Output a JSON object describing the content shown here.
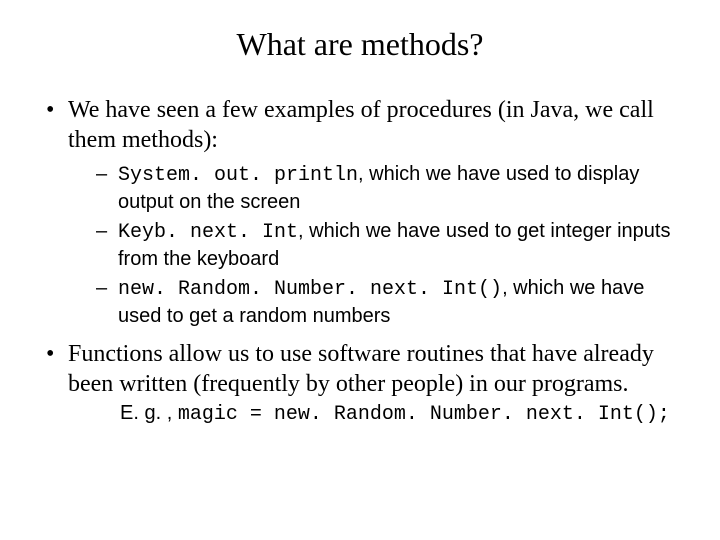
{
  "title": "What are methods?",
  "bullet1": {
    "text": "We have seen a few examples of procedures (in Java, we call them methods):",
    "subs": [
      {
        "code": "System. out. println",
        "text": ", which we have used to display output on the screen"
      },
      {
        "code": "Keyb. next. Int",
        "text": ", which we have used to get integer inputs from the keyboard"
      },
      {
        "code": "new. Random. Number. next. Int()",
        "text": ",  which we have used to get a random numbers"
      }
    ]
  },
  "bullet2": {
    "text": "Functions allow us to use software routines that have already been written (frequently by other people) in our programs."
  },
  "eg": {
    "prefix": "E. g. ,  ",
    "code": "magic = new. Random. Number. next. Int();"
  }
}
